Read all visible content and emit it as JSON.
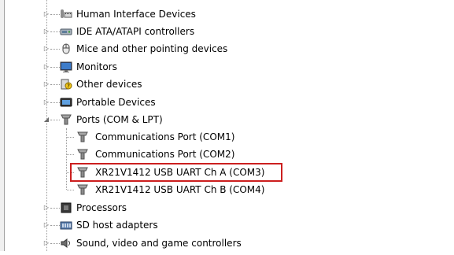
{
  "device_tree": {
    "items": [
      {
        "label": "Human Interface Devices",
        "icon": "hid-icon",
        "expanded": false
      },
      {
        "label": "IDE ATA/ATAPI controllers",
        "icon": "ide-controller-icon",
        "expanded": false
      },
      {
        "label": "Mice and other pointing devices",
        "icon": "mouse-icon",
        "expanded": false
      },
      {
        "label": "Monitors",
        "icon": "monitor-icon",
        "expanded": false
      },
      {
        "label": "Other devices",
        "icon": "unknown-device-icon",
        "expanded": false
      },
      {
        "label": "Portable Devices",
        "icon": "portable-device-icon",
        "expanded": false
      },
      {
        "label": "Ports (COM & LPT)",
        "icon": "port-icon",
        "expanded": true,
        "children": [
          {
            "label": "Communications Port (COM1)",
            "icon": "port-icon"
          },
          {
            "label": "Communications Port (COM2)",
            "icon": "port-icon"
          },
          {
            "label": "XR21V1412 USB UART Ch A (COM3)",
            "icon": "port-icon",
            "highlighted": true
          },
          {
            "label": "XR21V1412 USB UART Ch B (COM4)",
            "icon": "port-icon"
          }
        ]
      },
      {
        "label": "Processors",
        "icon": "processor-icon",
        "expanded": false
      },
      {
        "label": "SD host adapters",
        "icon": "sd-adapter-icon",
        "expanded": false
      },
      {
        "label": "Sound, video and game controllers",
        "icon": "speaker-icon",
        "expanded": false
      }
    ]
  },
  "colors": {
    "highlight_border": "#cc1f1f",
    "tree_lines": "#9a9a9a",
    "expander": "#6a6a6a"
  }
}
